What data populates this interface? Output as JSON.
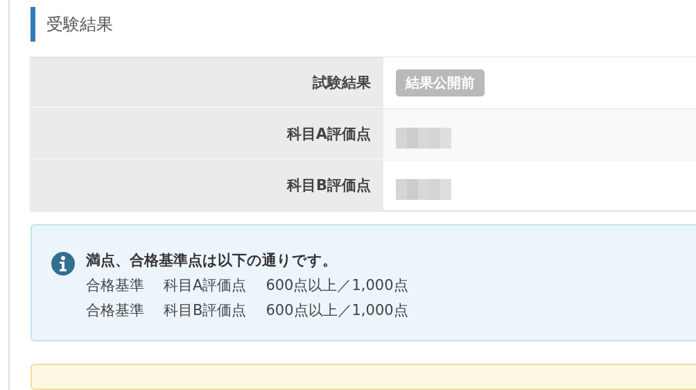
{
  "section": {
    "title": "受験結果"
  },
  "results": [
    {
      "label": "試験結果",
      "kind": "badge",
      "value": "結果公開前"
    },
    {
      "label": "科目A評価点",
      "kind": "redacted"
    },
    {
      "label": "科目B評価点",
      "kind": "redacted"
    }
  ],
  "info": {
    "title": "満点、合格基準点は以下の通りです。",
    "lines": [
      [
        "合格基準",
        "科目A評価点",
        "600点以上／1,000点"
      ],
      [
        "合格基準",
        "科目B評価点",
        "600点以上／1,000点"
      ]
    ]
  }
}
